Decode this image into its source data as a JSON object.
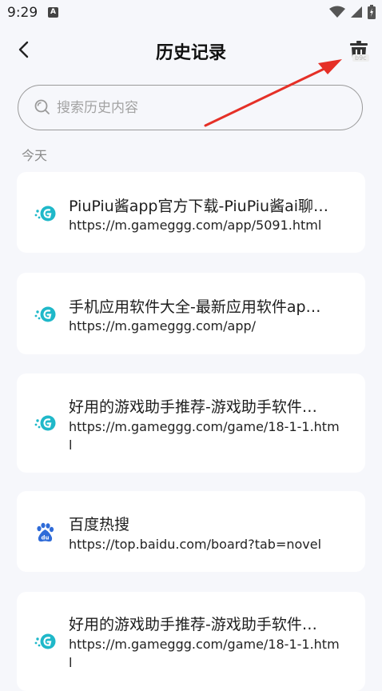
{
  "status_bar": {
    "time": "9:29",
    "notification_icon": "A"
  },
  "header": {
    "title": "历史记录",
    "back_icon": "chevron-left-icon",
    "delete_icon": "trash-icon",
    "mini_tag": "b9c"
  },
  "search": {
    "placeholder": "搜索历史内容",
    "value": ""
  },
  "section": {
    "label": "今天"
  },
  "history": [
    {
      "icon": "gameggg-icon",
      "title": "PiuPiu酱app官方下载-PiuPiu酱ai聊…",
      "url": "https://m.gameggg.com/app/5091.html"
    },
    {
      "icon": "gameggg-icon",
      "title": "手机应用软件大全-最新应用软件ap…",
      "url": "https://m.gameggg.com/app/"
    },
    {
      "icon": "gameggg-icon",
      "title": "好用的游戏助手推荐-游戏助手软件…",
      "url": "https://m.gameggg.com/game/18-1-1.html"
    },
    {
      "icon": "baidu-icon",
      "title": "百度热搜",
      "url": "https://top.baidu.com/board?tab=novel"
    },
    {
      "icon": "gameggg-icon",
      "title": "好用的游戏助手推荐-游戏助手软件…",
      "url": "https://m.gameggg.com/game/18-1-1.html"
    }
  ],
  "colors": {
    "background": "#f6f7fb",
    "card": "#ffffff",
    "accent_teal": "#1fb8c9",
    "annotation_arrow": "#e53027"
  }
}
